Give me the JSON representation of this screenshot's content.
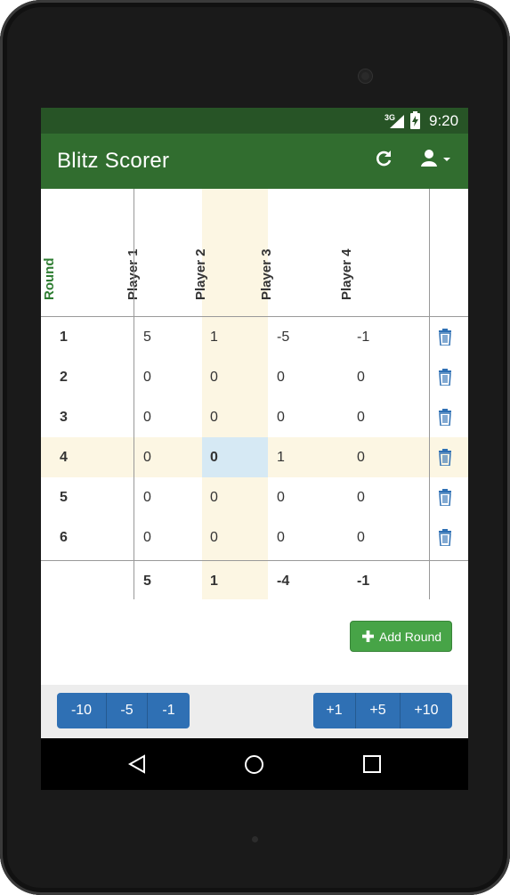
{
  "status": {
    "network": "3G",
    "time": "9:20"
  },
  "app": {
    "title": "Blitz Scorer"
  },
  "table": {
    "headers": [
      "Round",
      "Player 1",
      "Player 2",
      "Player 3",
      "Player 4"
    ],
    "rows": [
      {
        "round": "1",
        "scores": [
          "5",
          "1",
          "-5",
          "-1"
        ]
      },
      {
        "round": "2",
        "scores": [
          "0",
          "0",
          "0",
          "0"
        ]
      },
      {
        "round": "3",
        "scores": [
          "0",
          "0",
          "0",
          "0"
        ]
      },
      {
        "round": "4",
        "scores": [
          "0",
          "0",
          "1",
          "0"
        ]
      },
      {
        "round": "5",
        "scores": [
          "0",
          "0",
          "0",
          "0"
        ]
      },
      {
        "round": "6",
        "scores": [
          "0",
          "0",
          "0",
          "0"
        ]
      }
    ],
    "totals": [
      "5",
      "1",
      "-4",
      "-1"
    ]
  },
  "actions": {
    "add_round": "Add Round"
  },
  "score_buttons": {
    "minus": [
      "-10",
      "-5",
      "-1"
    ],
    "plus": [
      "+1",
      "+5",
      "+10"
    ]
  },
  "colors": {
    "status_bar": "#275426",
    "app_bar": "#316d2f",
    "highlight": "#fcf6e3",
    "selected_cell": "#d6e9f4",
    "button_blue": "#2f70b4",
    "button_green": "#47a447"
  },
  "icons": [
    "refresh-icon",
    "user-icon",
    "caret-down-icon",
    "trash-icon",
    "plus-icon",
    "back-icon",
    "home-icon",
    "recent-apps-icon"
  ]
}
